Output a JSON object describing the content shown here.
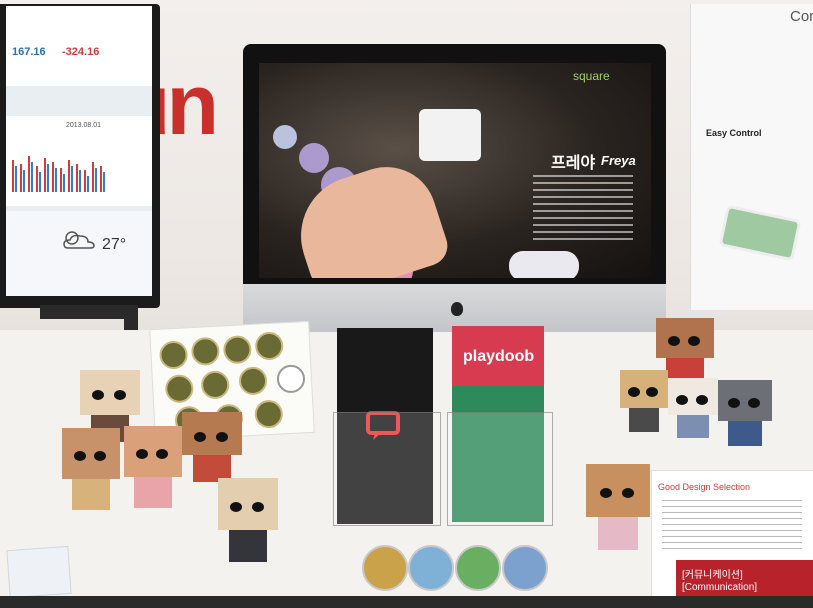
{
  "left_display": {
    "stat_1": "167.16",
    "stat_2": "-324.16",
    "date": "2013.08.01",
    "temperature": "27°"
  },
  "wall_sign": "un",
  "imac_screen": {
    "brand": "square",
    "title_ko": "프레야",
    "title_en": "Freya"
  },
  "brochure": {
    "logo": "playdoob"
  },
  "right_poster": {
    "title": "Con",
    "subtitle": "Easy Control"
  },
  "award_card": {
    "tag": "Good Design Selection",
    "band_ko": "[커뮤니케이션]",
    "band_en": "[Communication]"
  },
  "colors": {
    "wall_red": "#c9302c",
    "brochure_red": "#d63b4f",
    "brochure_green": "#2f8a5b",
    "card_band": "#b8232b"
  }
}
